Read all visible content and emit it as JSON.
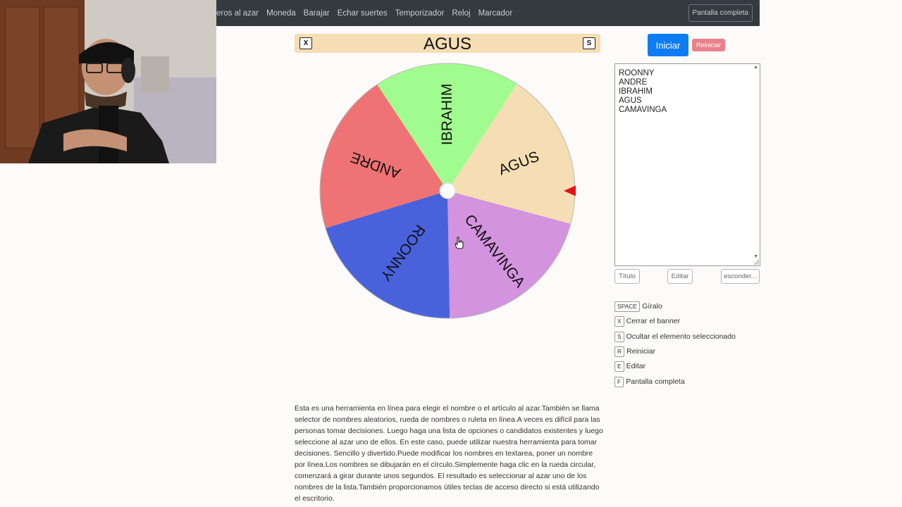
{
  "nav": {
    "links": [
      "eros al azar",
      "Moneda",
      "Barajar",
      "Echar suertes",
      "Temporizador",
      "Reloj",
      "Marcador"
    ],
    "fullscreen_label": "Pantalla completa"
  },
  "banner": {
    "close_key": "X",
    "hide_key": "S",
    "title": "AGUS"
  },
  "wheel": {
    "segments": [
      {
        "label": "IBRAHIM",
        "color": "#a1fc8f"
      },
      {
        "label": "AGUS",
        "color": "#f5deb3"
      },
      {
        "label": "CAMAVINGA",
        "color": "#d393de"
      },
      {
        "label": "ROONNY",
        "color": "#4962dc"
      },
      {
        "label": "ANDRE",
        "color": "#ef7374"
      }
    ],
    "pointer_color": "#e0141a"
  },
  "controls": {
    "start_label": "Iniciar",
    "reset_label": "Reiniciar"
  },
  "names_list": [
    "ROONNY",
    "ANDRE",
    "IBRAHIM",
    "AGUS",
    "CAMAVINGA"
  ],
  "list_buttons": {
    "title": "Título",
    "edit": "Editar",
    "hide": "esconder..."
  },
  "shortcuts": [
    {
      "key": "SPACE",
      "label": "Gíralo"
    },
    {
      "key": "X",
      "label": "Cerrar el banner"
    },
    {
      "key": "S",
      "label": "Ocultar el elemento seleccionado"
    },
    {
      "key": "R",
      "label": "Reiniciar"
    },
    {
      "key": "E",
      "label": "Editar"
    },
    {
      "key": "F",
      "label": "Pantalla completa"
    }
  ],
  "description": "Esta es una herramienta en línea para elegir el nombre o el artículo al azar.También se llama selector de nombres aleatorios, rueda de nombres o ruleta en línea.A veces es difícil para las personas tomar decisiones. Luego haga una lista de opciones o candidatos existentes y luego seleccione al azar uno de ellos. En este caso, puede utilizar nuestra herramienta para tomar decisiones. Sencillo y divertido.Puede modificar los nombres en textarea, poner un nombre por línea.Los nombres se dibujarán en el círculo.Simplemente haga clic en la rueda circular, comenzará a girar durante unos segundos. El resultado es seleccionar al azar uno de los nombres de la lista.También proporcionamos útiles teclas de acceso directo si está utilizando el escritorio."
}
